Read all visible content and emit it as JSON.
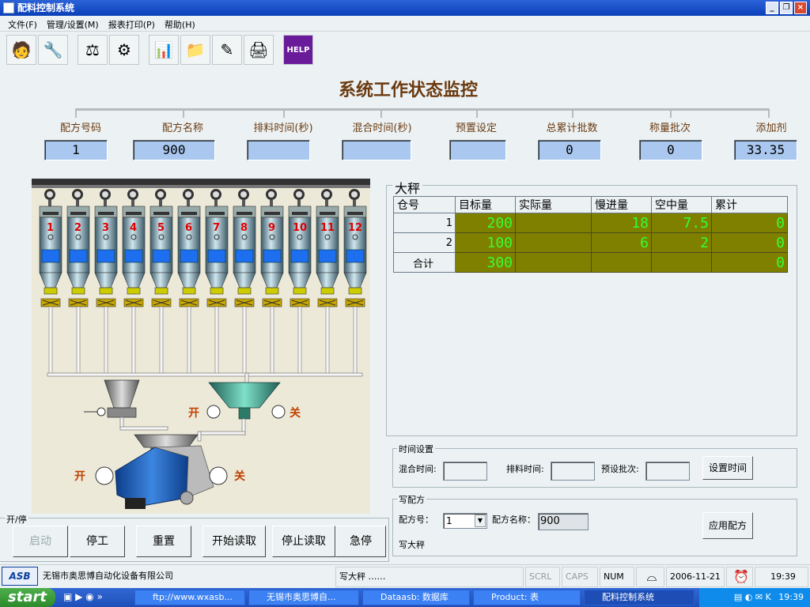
{
  "window": {
    "title": "配料控制系统"
  },
  "menu": [
    "文件(F)",
    "管理/设置(M)",
    "报表打印(P)",
    "帮助(H)"
  ],
  "toolbar_icons": [
    "user-icon",
    "settings-icon",
    "scale-icon",
    "gear-icon",
    "report-icon",
    "folder-icon",
    "edit-icon",
    "print-icon",
    "help-icon"
  ],
  "toolbar_help_label": "HELP",
  "page_title": "系统工作状态监控",
  "params": [
    {
      "label": "配方号码",
      "value": "1"
    },
    {
      "label": "配方名称",
      "value": "900"
    },
    {
      "label": "排料时间(秒)",
      "value": ""
    },
    {
      "label": "混合时间(秒)",
      "value": ""
    },
    {
      "label": "预置设定",
      "value": ""
    },
    {
      "label": "总累计批数",
      "value": "0"
    },
    {
      "label": "称量批次",
      "value": "0"
    },
    {
      "label": "添加剂",
      "value": "33.35"
    }
  ],
  "silos": [
    "1",
    "2",
    "3",
    "4",
    "5",
    "6",
    "7",
    "8",
    "9",
    "10",
    "11",
    "12"
  ],
  "valves": {
    "open": "开",
    "close": "关"
  },
  "scale": {
    "title": "大秤",
    "columns": [
      "仓号",
      "目标量",
      "实际量",
      "慢进量",
      "空中量",
      "累计"
    ],
    "rows": [
      {
        "bin": "1",
        "target": "200",
        "actual": "",
        "slow": "18",
        "air": "7.5",
        "total": "0"
      },
      {
        "bin": "2",
        "target": "100",
        "actual": "",
        "slow": "6",
        "air": "2",
        "total": "0"
      },
      {
        "bin": "合计",
        "target": "300",
        "actual": "",
        "slow": "",
        "air": "",
        "total": "0"
      }
    ]
  },
  "time_settings": {
    "title": "时间设置",
    "mix_label": "混合时间:",
    "discharge_label": "排料时间:",
    "preset_label": "预设批次:",
    "button": "设置时间"
  },
  "write_recipe": {
    "title": "写配方",
    "no_label": "配方号：",
    "no_value": "1",
    "name_label": "配方名称：",
    "name_value": "900",
    "button": "应用配方",
    "scale_label": "写大秤"
  },
  "control": {
    "title": "开/停",
    "buttons": [
      "启动",
      "停工",
      "重置",
      "开始读取",
      "停止读取",
      "急停"
    ]
  },
  "status": {
    "company": "无锡市奥思博自动化设备有限公司",
    "logo": "ASB",
    "message": "写大秤 ……",
    "scrl": "SCRL",
    "caps": "CAPS",
    "num": "NUM",
    "date": "2006-11-21",
    "time": "19:39"
  },
  "taskbar": {
    "start": "start",
    "tasks": [
      "ftp://www.wxasb...",
      "无锡市奥思博自...",
      "Dataasb: 数据库",
      "Product: 表",
      "配料控制系统"
    ],
    "clock": "19:39"
  },
  "colors": {
    "accent": "#6B3A10",
    "scale_bg": "#808000",
    "scale_text": "#33FF33"
  }
}
